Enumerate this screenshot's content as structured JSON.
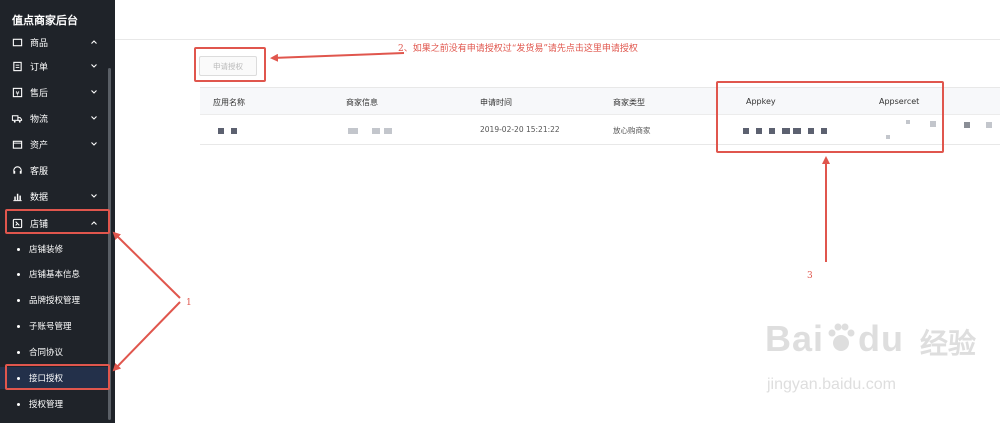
{
  "sidebar": {
    "brand": "值点商家后台",
    "top_item": "商品",
    "items": [
      {
        "label": "订单",
        "icon": "order-icon"
      },
      {
        "label": "售后",
        "icon": "after-sale-icon"
      },
      {
        "label": "物流",
        "icon": "truck-icon"
      },
      {
        "label": "资产",
        "icon": "wallet-icon"
      },
      {
        "label": "客服",
        "icon": "headset-icon"
      },
      {
        "label": "数据",
        "icon": "bar-chart-icon"
      },
      {
        "label": "店铺",
        "icon": "shop-icon"
      }
    ],
    "sub_items": [
      "店铺装修",
      "店铺基本信息",
      "品牌授权管理",
      "子账号管理",
      "合同协议",
      "接口授权",
      "授权管理"
    ],
    "active_sub": "接口授权"
  },
  "main": {
    "apply_button": "申请授权",
    "table": {
      "headers": [
        "应用名称",
        "商家信息",
        "申请时间",
        "商家类型",
        "Appkey",
        "Appsercet"
      ],
      "row": {
        "apply_time": "2019-02-20 15:21:22",
        "merchant_type": "放心购商家"
      }
    }
  },
  "annotations": {
    "note1": "1",
    "note2": "2、如果之前没有申请授权过“发货易”请先点击这里申请授权",
    "note3": "3"
  },
  "watermark": {
    "logo_text": "Bai",
    "logo_suffix": "du",
    "logo_cn": "经验",
    "url": "jingyan.baidu.com"
  },
  "colors": {
    "sidebar_bg": "#1f2329",
    "annotation_red": "#e0564d",
    "active_bg": "#23304a"
  }
}
